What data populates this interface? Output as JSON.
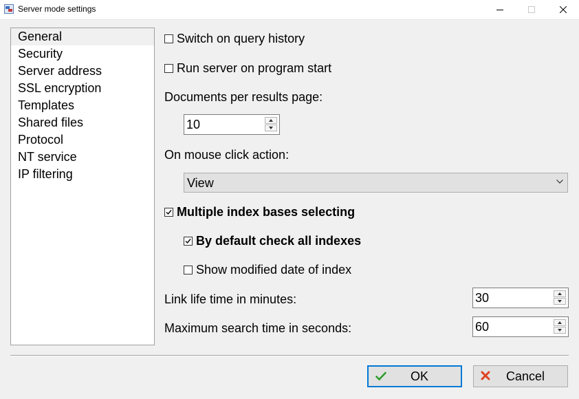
{
  "window": {
    "title": "Server mode settings"
  },
  "nav": {
    "items": [
      {
        "label": "General",
        "selected": true
      },
      {
        "label": "Security"
      },
      {
        "label": "Server address"
      },
      {
        "label": "SSL encryption"
      },
      {
        "label": "Templates"
      },
      {
        "label": "Shared files"
      },
      {
        "label": "Protocol"
      },
      {
        "label": "NT service"
      },
      {
        "label": "IP filtering"
      }
    ]
  },
  "general": {
    "query_history": {
      "label": "Switch on query history",
      "checked": false
    },
    "run_on_start": {
      "label": "Run server on program start",
      "checked": false
    },
    "docs_per_page": {
      "label": "Documents per results page:",
      "value": "10"
    },
    "mouse_click": {
      "label": "On mouse click action:",
      "value": "View"
    },
    "multi_index": {
      "label": "Multiple index bases selecting",
      "checked": true
    },
    "check_all": {
      "label": "By default check all indexes",
      "checked": true
    },
    "show_modified": {
      "label": "Show modified date of index",
      "checked": false
    },
    "link_life": {
      "label": "Link life time in minutes:",
      "value": "30"
    },
    "max_search": {
      "label": "Maximum search time in seconds:",
      "value": "60"
    }
  },
  "buttons": {
    "ok": "OK",
    "cancel": "Cancel"
  },
  "colors": {
    "accent": "#0078d7",
    "ok_icon": "#2e9e2e",
    "cancel_icon": "#e04020"
  }
}
